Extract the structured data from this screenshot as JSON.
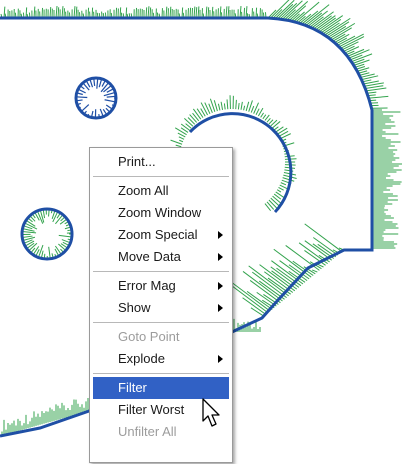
{
  "colors": {
    "outline": "#1f4fa5",
    "whiskers": "#33a34d",
    "highlight": "#3161c5",
    "disabled": "#9c9c9c"
  },
  "menu": {
    "items": [
      {
        "label": "Print...",
        "submenu": false,
        "disabled": false,
        "highlighted": false
      },
      {
        "separator": true
      },
      {
        "label": "Zoom All",
        "submenu": false,
        "disabled": false,
        "highlighted": false
      },
      {
        "label": "Zoom Window",
        "submenu": false,
        "disabled": false,
        "highlighted": false
      },
      {
        "label": "Zoom Special",
        "submenu": true,
        "disabled": false,
        "highlighted": false
      },
      {
        "label": "Move Data",
        "submenu": true,
        "disabled": false,
        "highlighted": false
      },
      {
        "separator": true
      },
      {
        "label": "Error Mag",
        "submenu": true,
        "disabled": false,
        "highlighted": false
      },
      {
        "label": "Show",
        "submenu": true,
        "disabled": false,
        "highlighted": false
      },
      {
        "separator": true
      },
      {
        "label": "Goto Point",
        "submenu": false,
        "disabled": true,
        "highlighted": false
      },
      {
        "label": "Explode",
        "submenu": true,
        "disabled": false,
        "highlighted": false
      },
      {
        "separator": true
      },
      {
        "label": "Filter",
        "submenu": false,
        "disabled": false,
        "highlighted": true
      },
      {
        "label": "Filter Worst",
        "submenu": false,
        "disabled": false,
        "highlighted": false
      },
      {
        "label": "Unfilter All",
        "submenu": false,
        "disabled": true,
        "highlighted": false
      }
    ]
  }
}
